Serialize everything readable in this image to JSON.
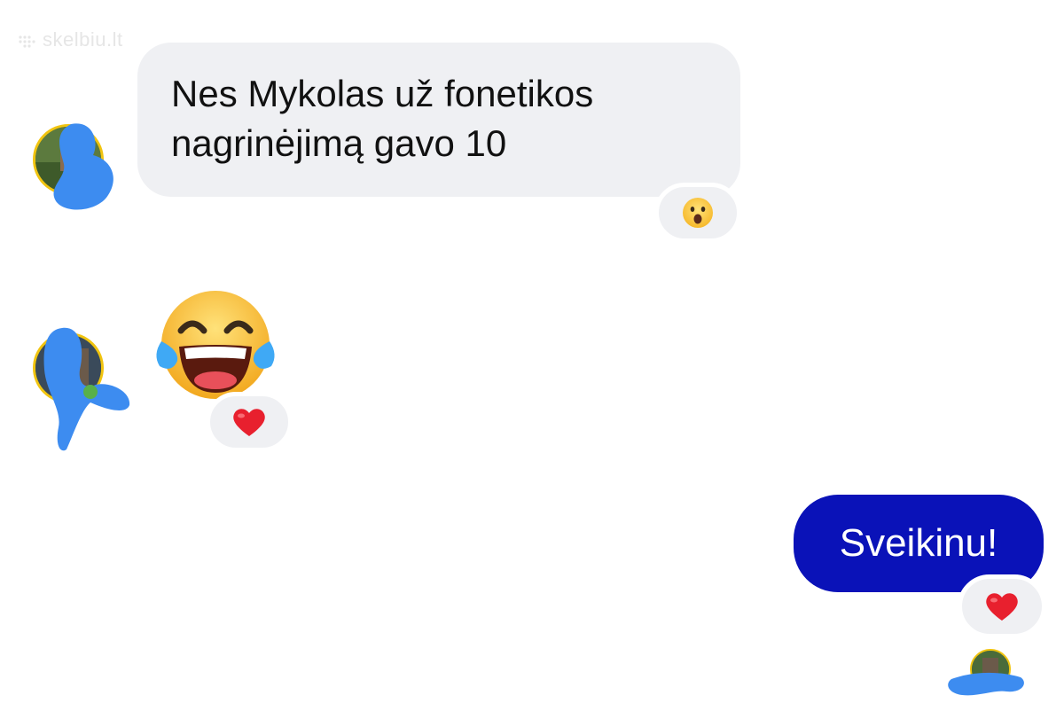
{
  "watermark": {
    "text": "skelbiu.lt"
  },
  "messages": [
    {
      "direction": "incoming",
      "lines": [
        "Nes Mykolas už fonetikos",
        "nagrinėjimą gavo 10"
      ],
      "reaction": "surprised-face-icon"
    },
    {
      "direction": "incoming",
      "content": "laughing-crying-emoji",
      "reaction": "heart-icon"
    },
    {
      "direction": "outgoing",
      "text": "Sveikinu!",
      "reaction": "heart-icon"
    }
  ],
  "colors": {
    "incoming_bubble": "#eff0f3",
    "outgoing_bubble": "#0a12b8",
    "redaction_scribble": "#3d8cf0",
    "avatar_ring": "#f1c40f",
    "heart": "#e8202e"
  }
}
